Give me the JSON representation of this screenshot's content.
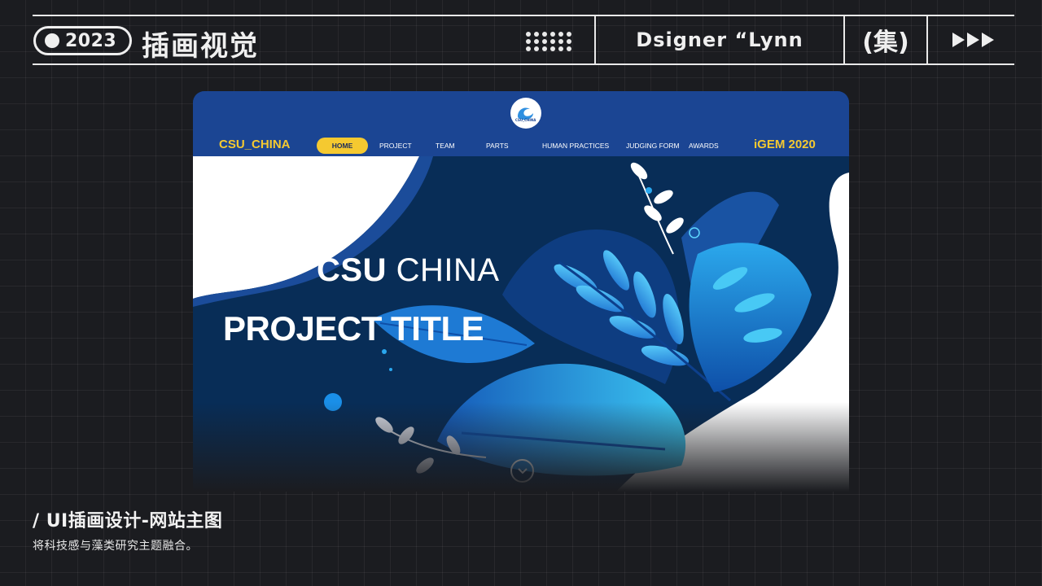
{
  "header": {
    "year": "2023",
    "title": "插画视觉",
    "designer": "Dsigner  “Lynn",
    "set_label": "(集)",
    "arrows_icon": "triple-play-arrow-icon"
  },
  "mockup": {
    "logo_text": "CSU_CHINA",
    "brand_left": "CSU_CHINA",
    "brand_right": "iGEM 2020",
    "nav": {
      "home": "HOME",
      "items": [
        "PROJECT",
        "TEAM",
        "PARTS",
        "HUMAN PRACTICES",
        "JUDGING FORM",
        "AWARDS"
      ]
    },
    "hero": {
      "csu_bold": "CSU",
      "csu_light": "CHINA",
      "project_title": "PROJECT TITLE",
      "scroll_icon": "chevron-down-circle-icon"
    },
    "colors": {
      "nav_bg": "#1b4593",
      "accent_yellow": "#f5c930",
      "hero_dark": "#082d57",
      "leaf_light": "#37c2f0",
      "leaf_mid": "#1c7fd6"
    }
  },
  "caption": {
    "title": "/  UI插画设计-网站主图",
    "subtitle": "将科技感与藻类研究主题融合。"
  }
}
